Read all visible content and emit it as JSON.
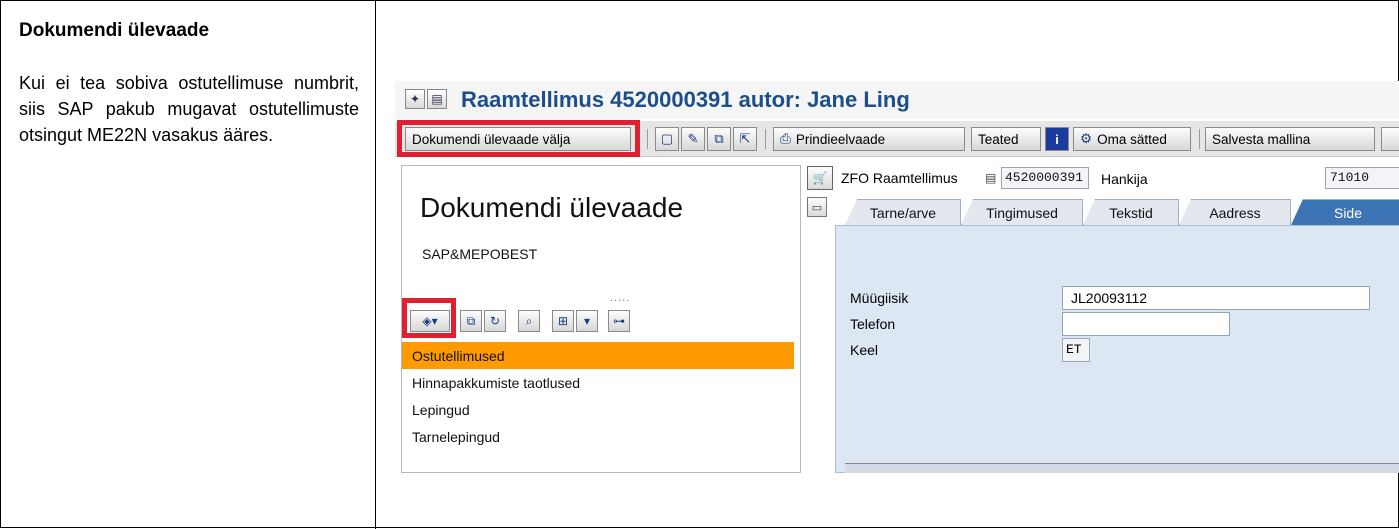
{
  "doc": {
    "heading": "Dokumendi ülevaade",
    "body": "Kui ei tea sobiva ostutellimuse numbrit, siis SAP pakub mugavat ostutellimuste otsingut ME22N vasakus ääres."
  },
  "sap": {
    "window_title": "Raamtellimus 4520000391 autor: Jane Ling",
    "toolbar": {
      "doc_overview_btn": "Dokumendi ülevaade välja",
      "print_preview_btn": "Prindieelvaade",
      "messages_btn": "Teated",
      "personal_settings_btn": "Oma sätted",
      "save_template_btn": "Salvesta mallina"
    },
    "left_pane": {
      "title": "Dokumendi ülevaade",
      "subtitle": "SAP&MEPOBEST",
      "items": [
        {
          "label": "Ostutellimused",
          "selected": true
        },
        {
          "label": "Hinnapakkumiste taotlused",
          "selected": false
        },
        {
          "label": "Lepingud",
          "selected": false
        },
        {
          "label": "Tarnelepingud",
          "selected": false
        }
      ]
    },
    "header": {
      "doc_type": "ZFO Raamtellimus",
      "doc_number": "4520000391",
      "vendor_label": "Hankija",
      "vendor_value": "71010"
    },
    "tabs": [
      "Tarne/arve",
      "Tingimused",
      "Tekstid",
      "Aadress",
      "Side"
    ],
    "active_tab": "Side",
    "fields": {
      "salesperson_label": "Müügiisik",
      "salesperson_value": "JL20093112",
      "phone_label": "Telefon",
      "phone_value": "",
      "language_label": "Keel",
      "language_value": "ET"
    },
    "colors": {
      "title_blue": "#1c4f8a",
      "highlight_red": "#e02030",
      "selection_orange": "#ff9b00",
      "active_tab": "#3d74b6",
      "panel_bg": "#dce7f3"
    }
  }
}
